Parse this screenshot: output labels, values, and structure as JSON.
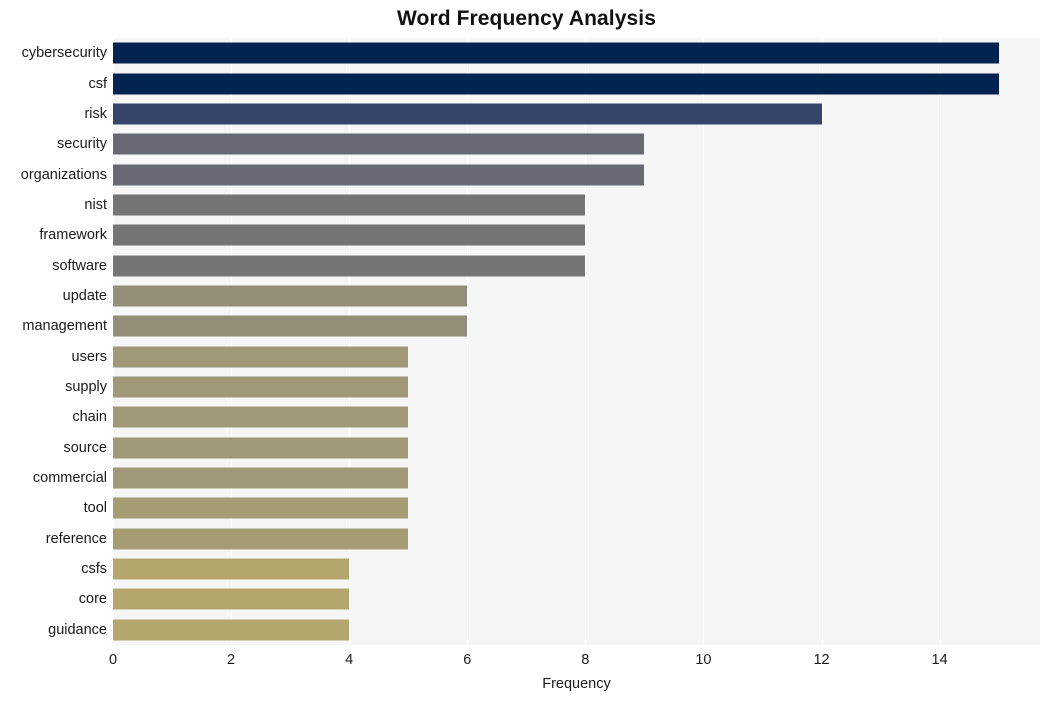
{
  "chart_data": {
    "type": "bar",
    "orientation": "horizontal",
    "title": "Word Frequency Analysis",
    "xlabel": "Frequency",
    "ylabel": "",
    "xlim": [
      0,
      15.7
    ],
    "xticks": [
      0,
      2,
      4,
      6,
      8,
      10,
      12,
      14
    ],
    "xtick_labels": [
      "0",
      "2",
      "4",
      "6",
      "8",
      "10",
      "12",
      "14"
    ],
    "grid": "vertical-white",
    "legend": "none",
    "plot_background": "#f6f6f7",
    "figure_background": "#ffffff",
    "categories": [
      "cybersecurity",
      "csf",
      "risk",
      "security",
      "organizations",
      "nist",
      "framework",
      "software",
      "update",
      "management",
      "users",
      "supply",
      "chain",
      "source",
      "commercial",
      "tool",
      "reference",
      "csfs",
      "core",
      "guidance"
    ],
    "values": [
      15,
      15,
      12,
      9,
      9,
      8,
      8,
      8,
      6,
      6,
      5,
      5,
      5,
      5,
      5,
      5,
      5,
      4,
      4,
      4
    ],
    "bar_colors": [
      "#032350",
      "#032350",
      "#38456b",
      "#676a74",
      "#676a74",
      "#757578",
      "#757578",
      "#757578",
      "#938e78",
      "#938e78",
      "#a09876",
      "#a09876",
      "#a09876",
      "#a09876",
      "#a09876",
      "#a69c74",
      "#a69c74",
      "#b4a76e",
      "#b4a76e",
      "#b4a76e"
    ]
  }
}
